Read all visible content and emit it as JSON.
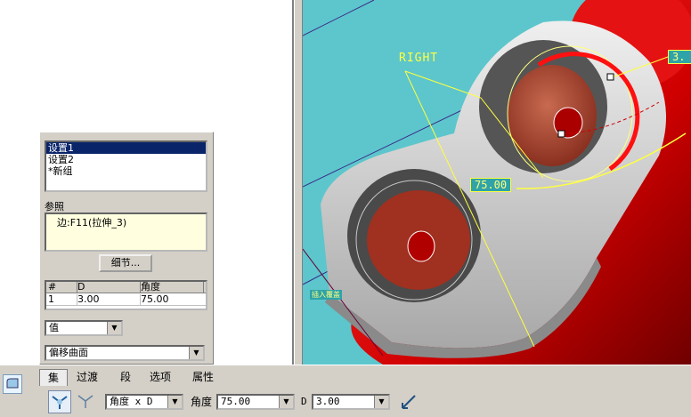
{
  "viewport": {
    "datum_label": "RIGHT",
    "dimension_angle": "75.00",
    "dimension_right": "3.",
    "small_tag": "插入覆盖"
  },
  "panel": {
    "sets": [
      "设置1",
      "设置2",
      "*新组"
    ],
    "ref_label": "参照",
    "ref_value": "边:F11(拉伸_3)",
    "details_button": "细节...",
    "table": {
      "headers": [
        "#",
        "D",
        "角度"
      ],
      "rows": [
        [
          "1",
          "3.00",
          "75.00"
        ]
      ]
    },
    "value_combo": "值",
    "surface_combo": "偏移曲面"
  },
  "dashboard": {
    "tabs": [
      "集",
      "过渡",
      "段",
      "选项",
      "属性"
    ],
    "mode_combo": "角度 x D",
    "angle_label": "角度",
    "angle_value": "75.00",
    "d_label": "D",
    "d_value": "3.00"
  },
  "colors": {
    "viewport_bg": "#5cc6cc",
    "part_gray": "#e0e0e0",
    "model_red": "#e01010",
    "dimension_yellow": "#ffff40",
    "selection_blue": "#0a246a"
  }
}
